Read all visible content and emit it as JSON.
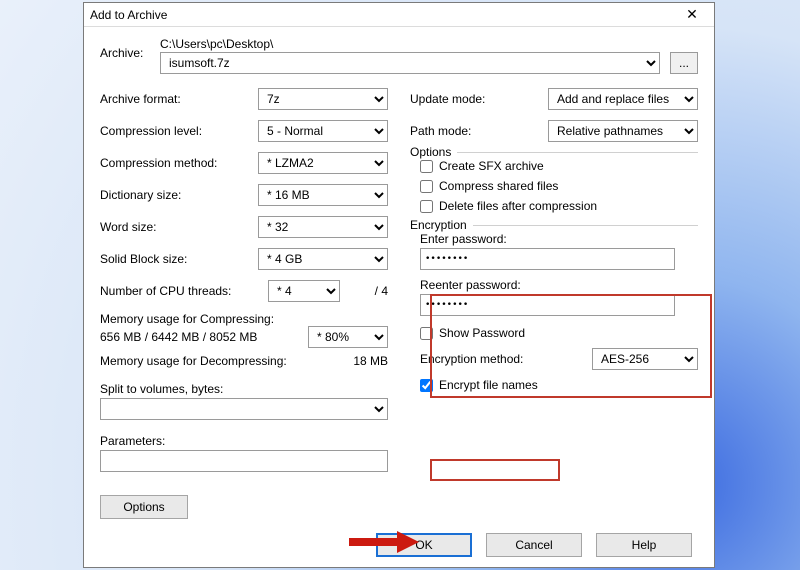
{
  "title": "Add to Archive",
  "archive": {
    "label": "Archive:",
    "path": "C:\\Users\\pc\\Desktop\\",
    "value": "isumsoft.7z",
    "browse": "..."
  },
  "left": {
    "format_label": "Archive format:",
    "format": "7z",
    "level_label": "Compression level:",
    "level": "5 - Normal",
    "method_label": "Compression method:",
    "method": "* LZMA2",
    "dict_label": "Dictionary size:",
    "dict": "* 16 MB",
    "word_label": "Word size:",
    "word": "* 32",
    "block_label": "Solid Block size:",
    "block": "* 4 GB",
    "threads_label": "Number of CPU threads:",
    "threads": "* 4",
    "threads_of": "/ 4",
    "mem_comp_label": "Memory usage for Compressing:",
    "mem_comp_val": "656 MB / 6442 MB / 8052 MB",
    "mem_pct": "* 80%",
    "mem_decomp_label": "Memory usage for Decompressing:",
    "mem_decomp_val": "18 MB",
    "split_label": "Split to volumes, bytes:",
    "params_label": "Parameters:",
    "options_btn": "Options"
  },
  "right": {
    "update_label": "Update mode:",
    "update": "Add and replace files",
    "pathmode_label": "Path mode:",
    "pathmode": "Relative pathnames",
    "options_legend": "Options",
    "opt_sfx": "Create SFX archive",
    "opt_shared": "Compress shared files",
    "opt_delete": "Delete files after compression",
    "enc_legend": "Encryption",
    "enter_pw": "Enter password:",
    "reenter_pw": "Reenter password:",
    "pw_value": "••••••••",
    "show_pw": "Show Password",
    "enc_method_label": "Encryption method:",
    "enc_method": "AES-256",
    "enc_names": "Encrypt file names"
  },
  "footer": {
    "ok": "OK",
    "cancel": "Cancel",
    "help": "Help"
  }
}
